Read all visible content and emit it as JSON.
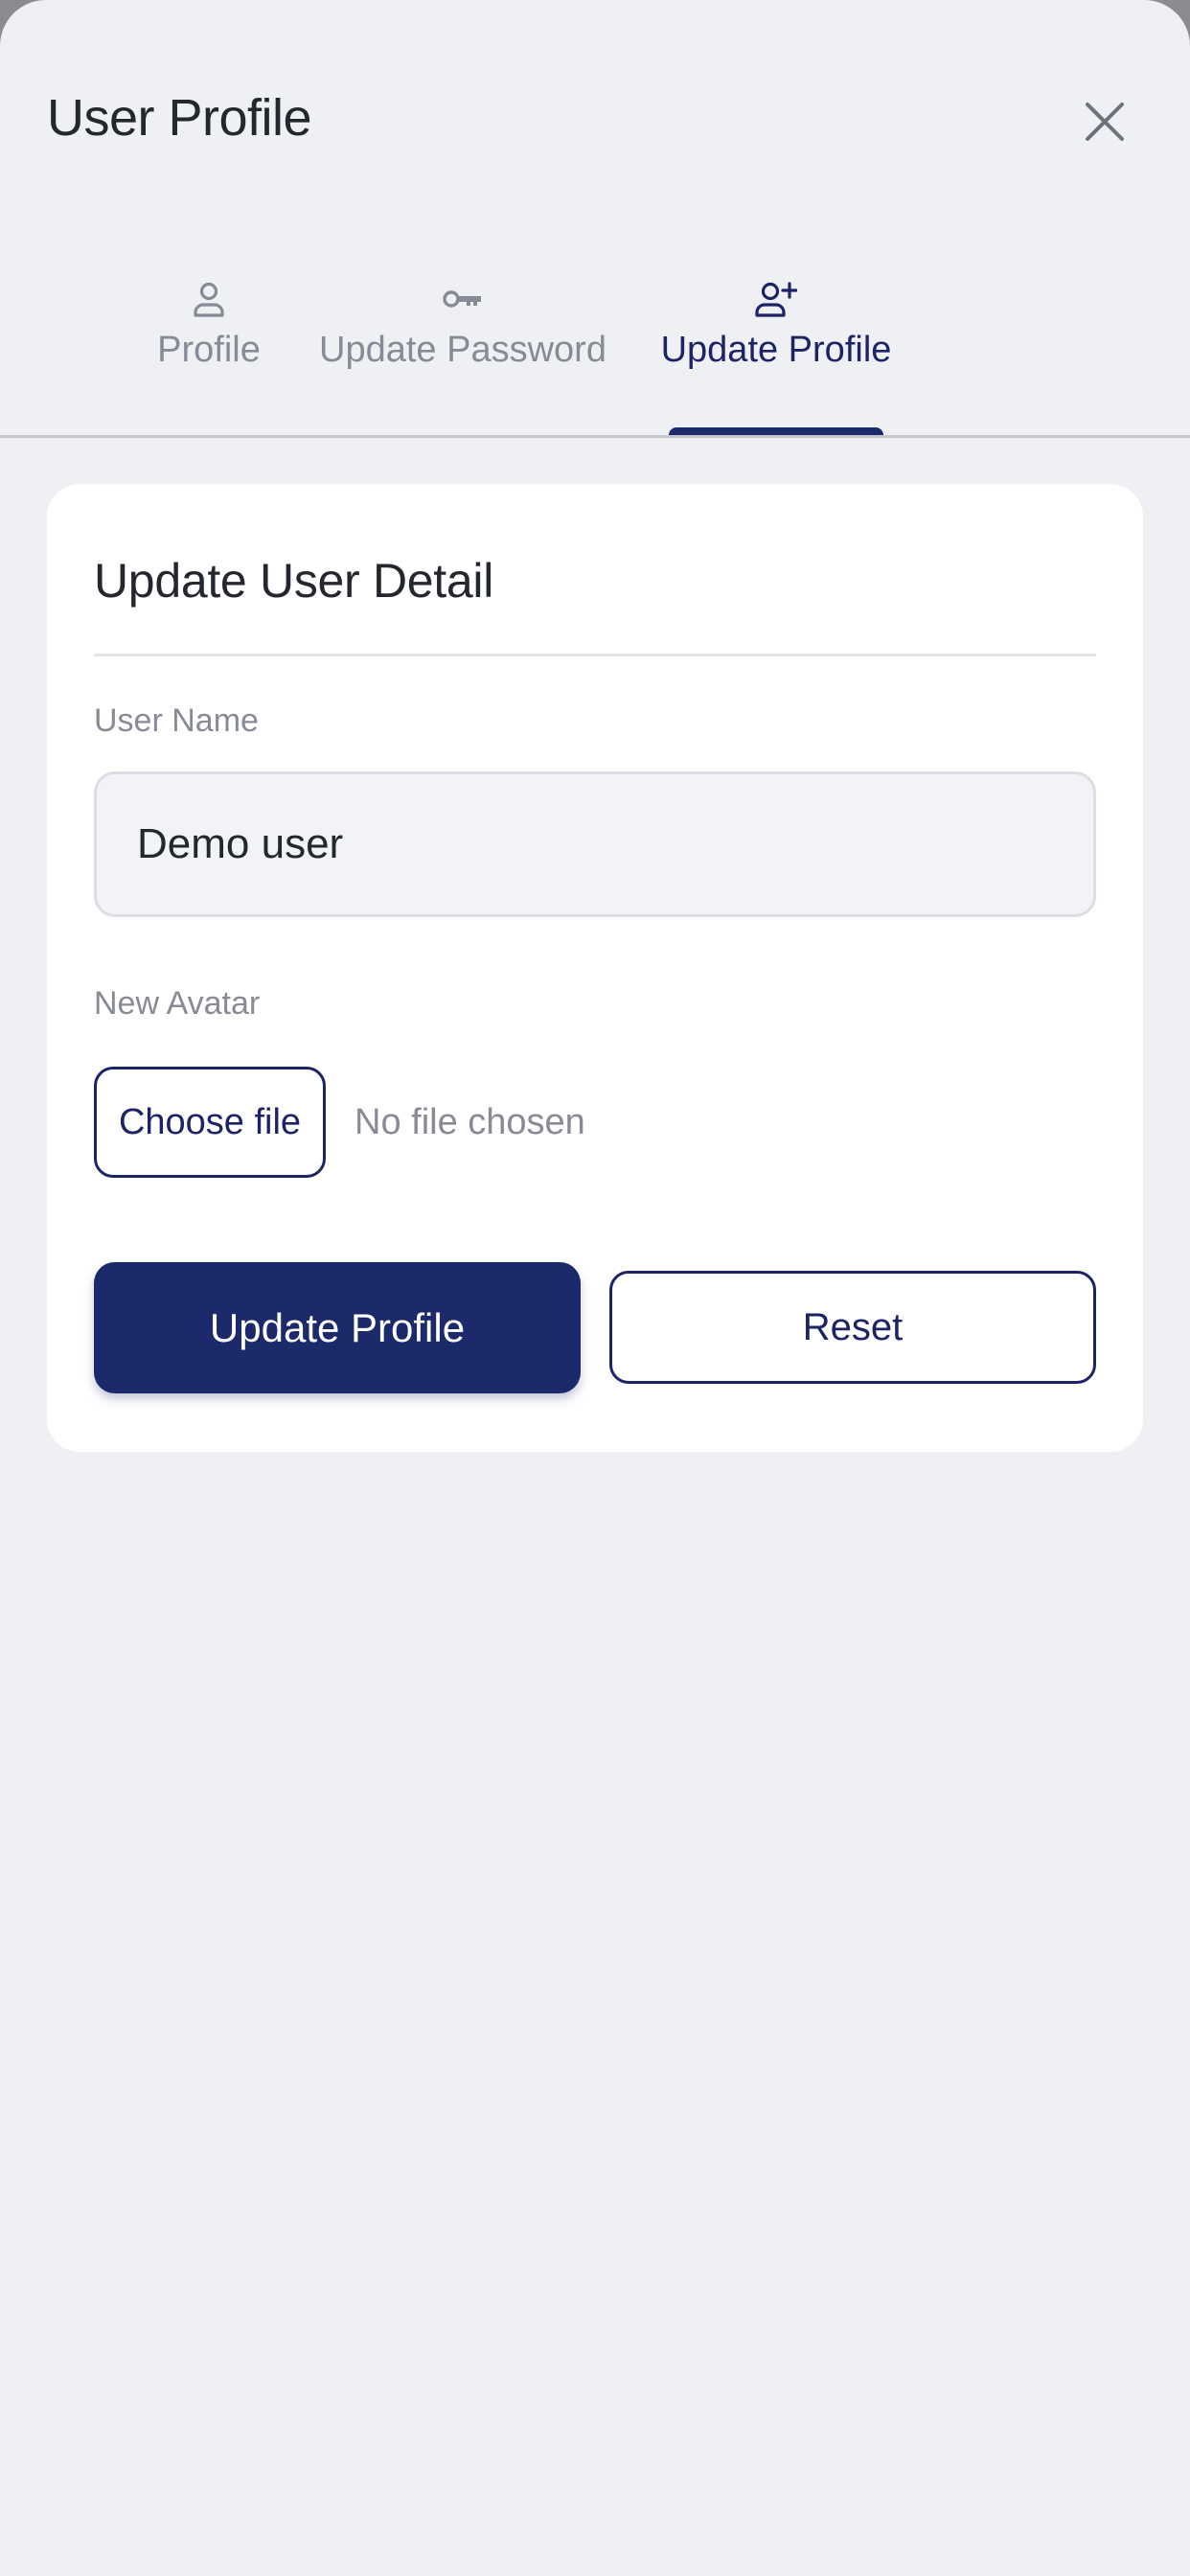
{
  "header": {
    "title": "User Profile",
    "close_icon": "close-icon"
  },
  "tabs": [
    {
      "label": "Profile",
      "icon": "user-icon",
      "active": false
    },
    {
      "label": "Update Password",
      "icon": "key-icon",
      "active": false
    },
    {
      "label": "Update Profile",
      "icon": "user-plus-icon",
      "active": true
    }
  ],
  "form": {
    "title": "Update User Detail",
    "username_label": "User Name",
    "username_value": "Demo user",
    "avatar_label": "New Avatar",
    "choose_file_label": "Choose file",
    "no_file_text": "No file chosen",
    "submit_label": "Update Profile",
    "reset_label": "Reset"
  },
  "colors": {
    "accent": "#1c2a6b",
    "background": "#eff0f4",
    "muted_text": "#888b96"
  }
}
